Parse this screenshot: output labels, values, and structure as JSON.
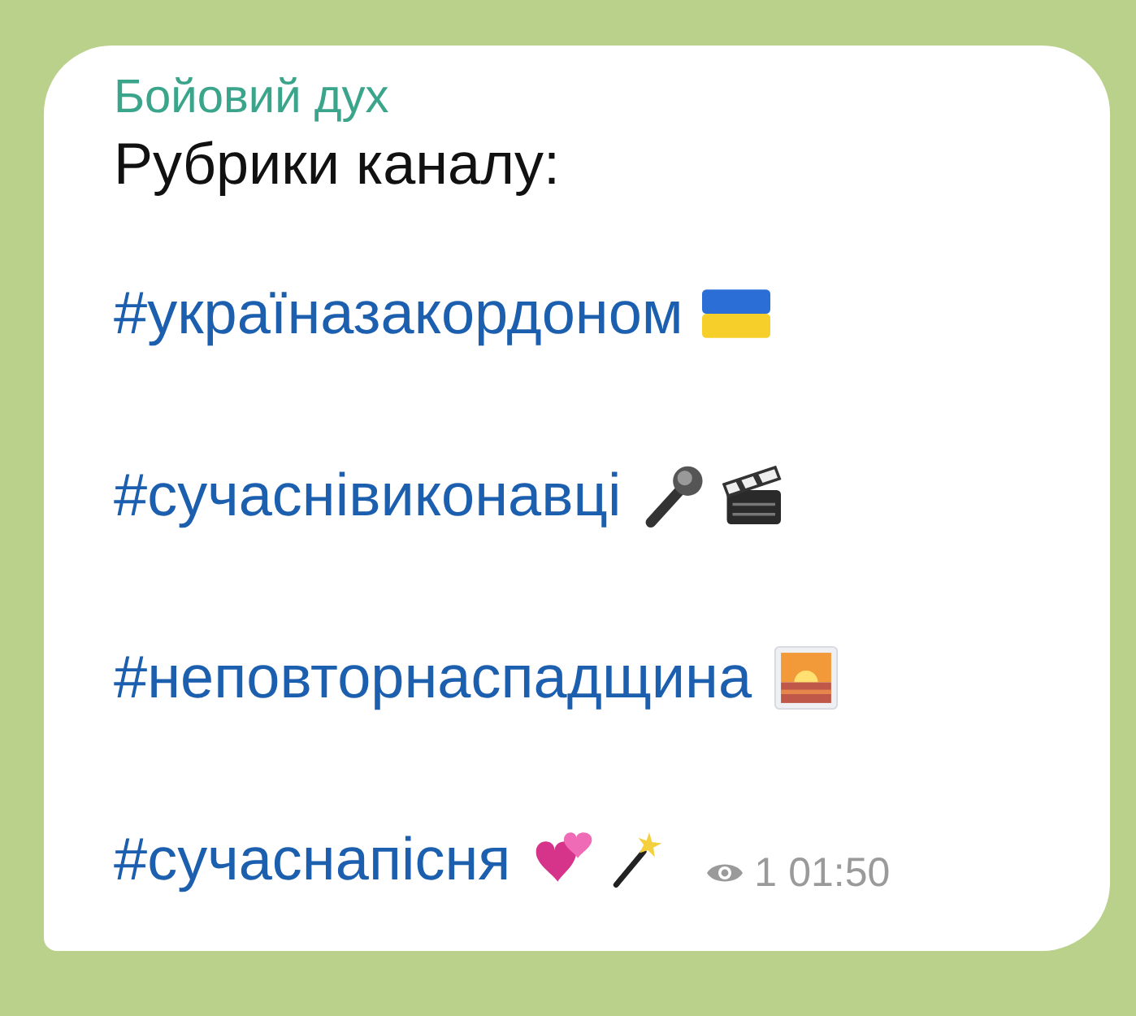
{
  "message": {
    "sender": "Бойовий дух",
    "heading": "Рубрики каналу:",
    "hashtags": [
      "#україназакордоном",
      "#сучаснівиконавці",
      "#неповторнаспадщина",
      "#сучаснапісня"
    ],
    "views": "1",
    "time": "01:50"
  }
}
